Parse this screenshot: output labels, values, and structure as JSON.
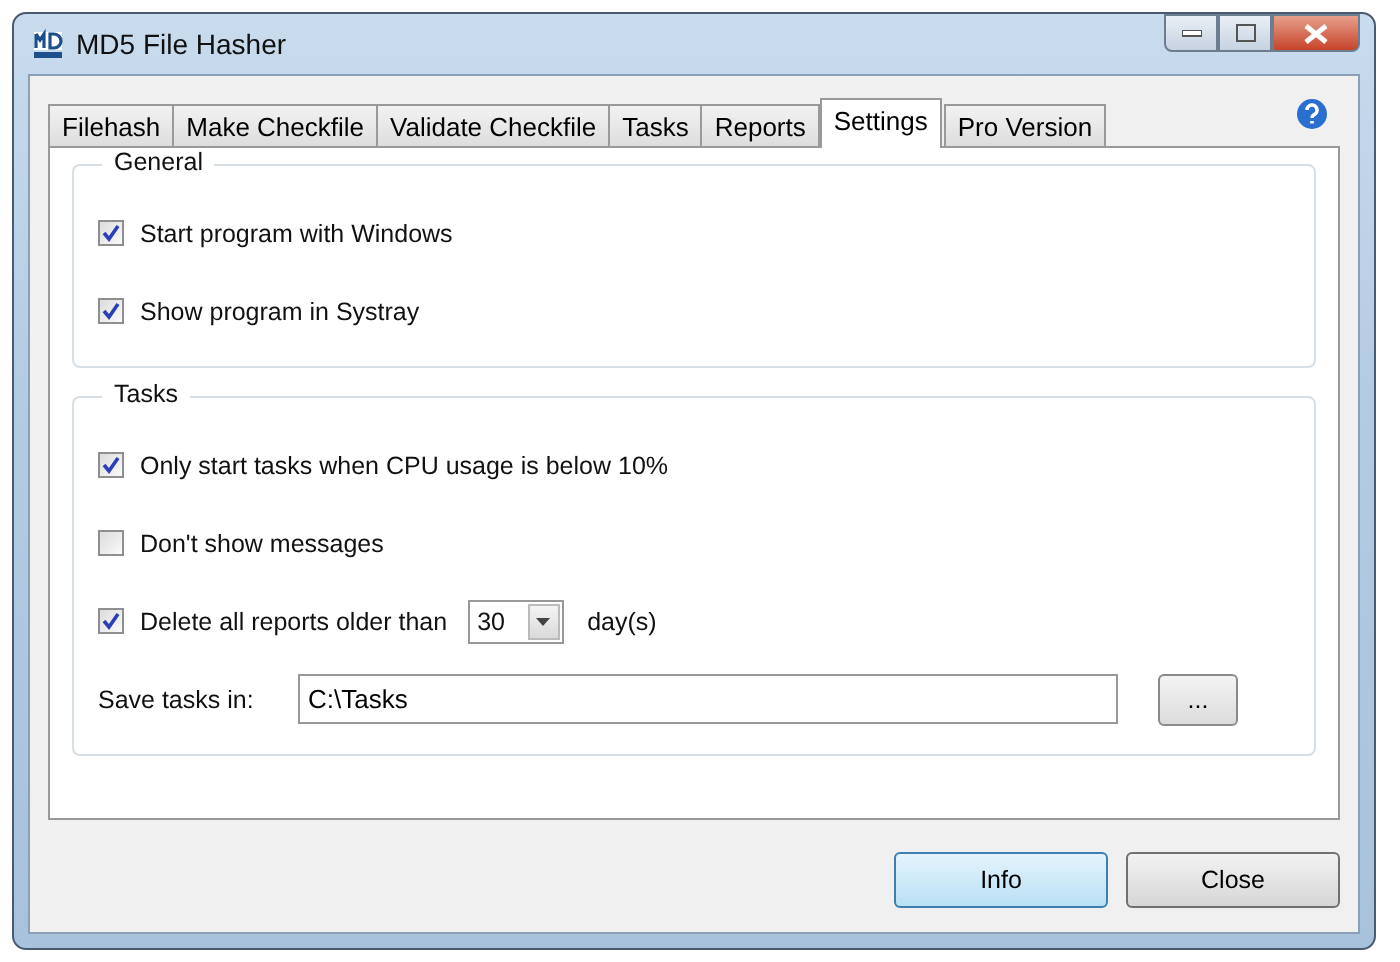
{
  "window": {
    "title": "MD5 File Hasher"
  },
  "tabs": [
    {
      "label": "Filehash",
      "selected": false
    },
    {
      "label": "Make Checkfile",
      "selected": false
    },
    {
      "label": "Validate Checkfile",
      "selected": false
    },
    {
      "label": "Tasks",
      "selected": false
    },
    {
      "label": "Reports",
      "selected": false
    },
    {
      "label": "Settings",
      "selected": true
    },
    {
      "label": "Pro Version",
      "selected": false
    }
  ],
  "groups": [
    {
      "title": "General",
      "items": [
        {
          "kind": "checkbox",
          "label": "Start program with Windows",
          "checked": true
        },
        {
          "kind": "checkbox",
          "label": "Show program in Systray",
          "checked": true
        }
      ]
    },
    {
      "title": "Tasks",
      "items": [
        {
          "kind": "checkbox",
          "label": "Only start tasks when CPU usage is below 10%",
          "checked": true
        },
        {
          "kind": "checkbox",
          "label": "Don't show messages",
          "checked": false
        },
        {
          "kind": "checkbox-spin",
          "label": "Delete all reports older than",
          "checked": true,
          "value": "30",
          "unit": "day(s)"
        },
        {
          "kind": "path",
          "label": "Save tasks in:",
          "value": "C:\\Tasks",
          "button": "..."
        }
      ]
    }
  ],
  "buttons": [
    {
      "label": "Info",
      "default": true
    },
    {
      "label": "Close",
      "default": false
    }
  ]
}
